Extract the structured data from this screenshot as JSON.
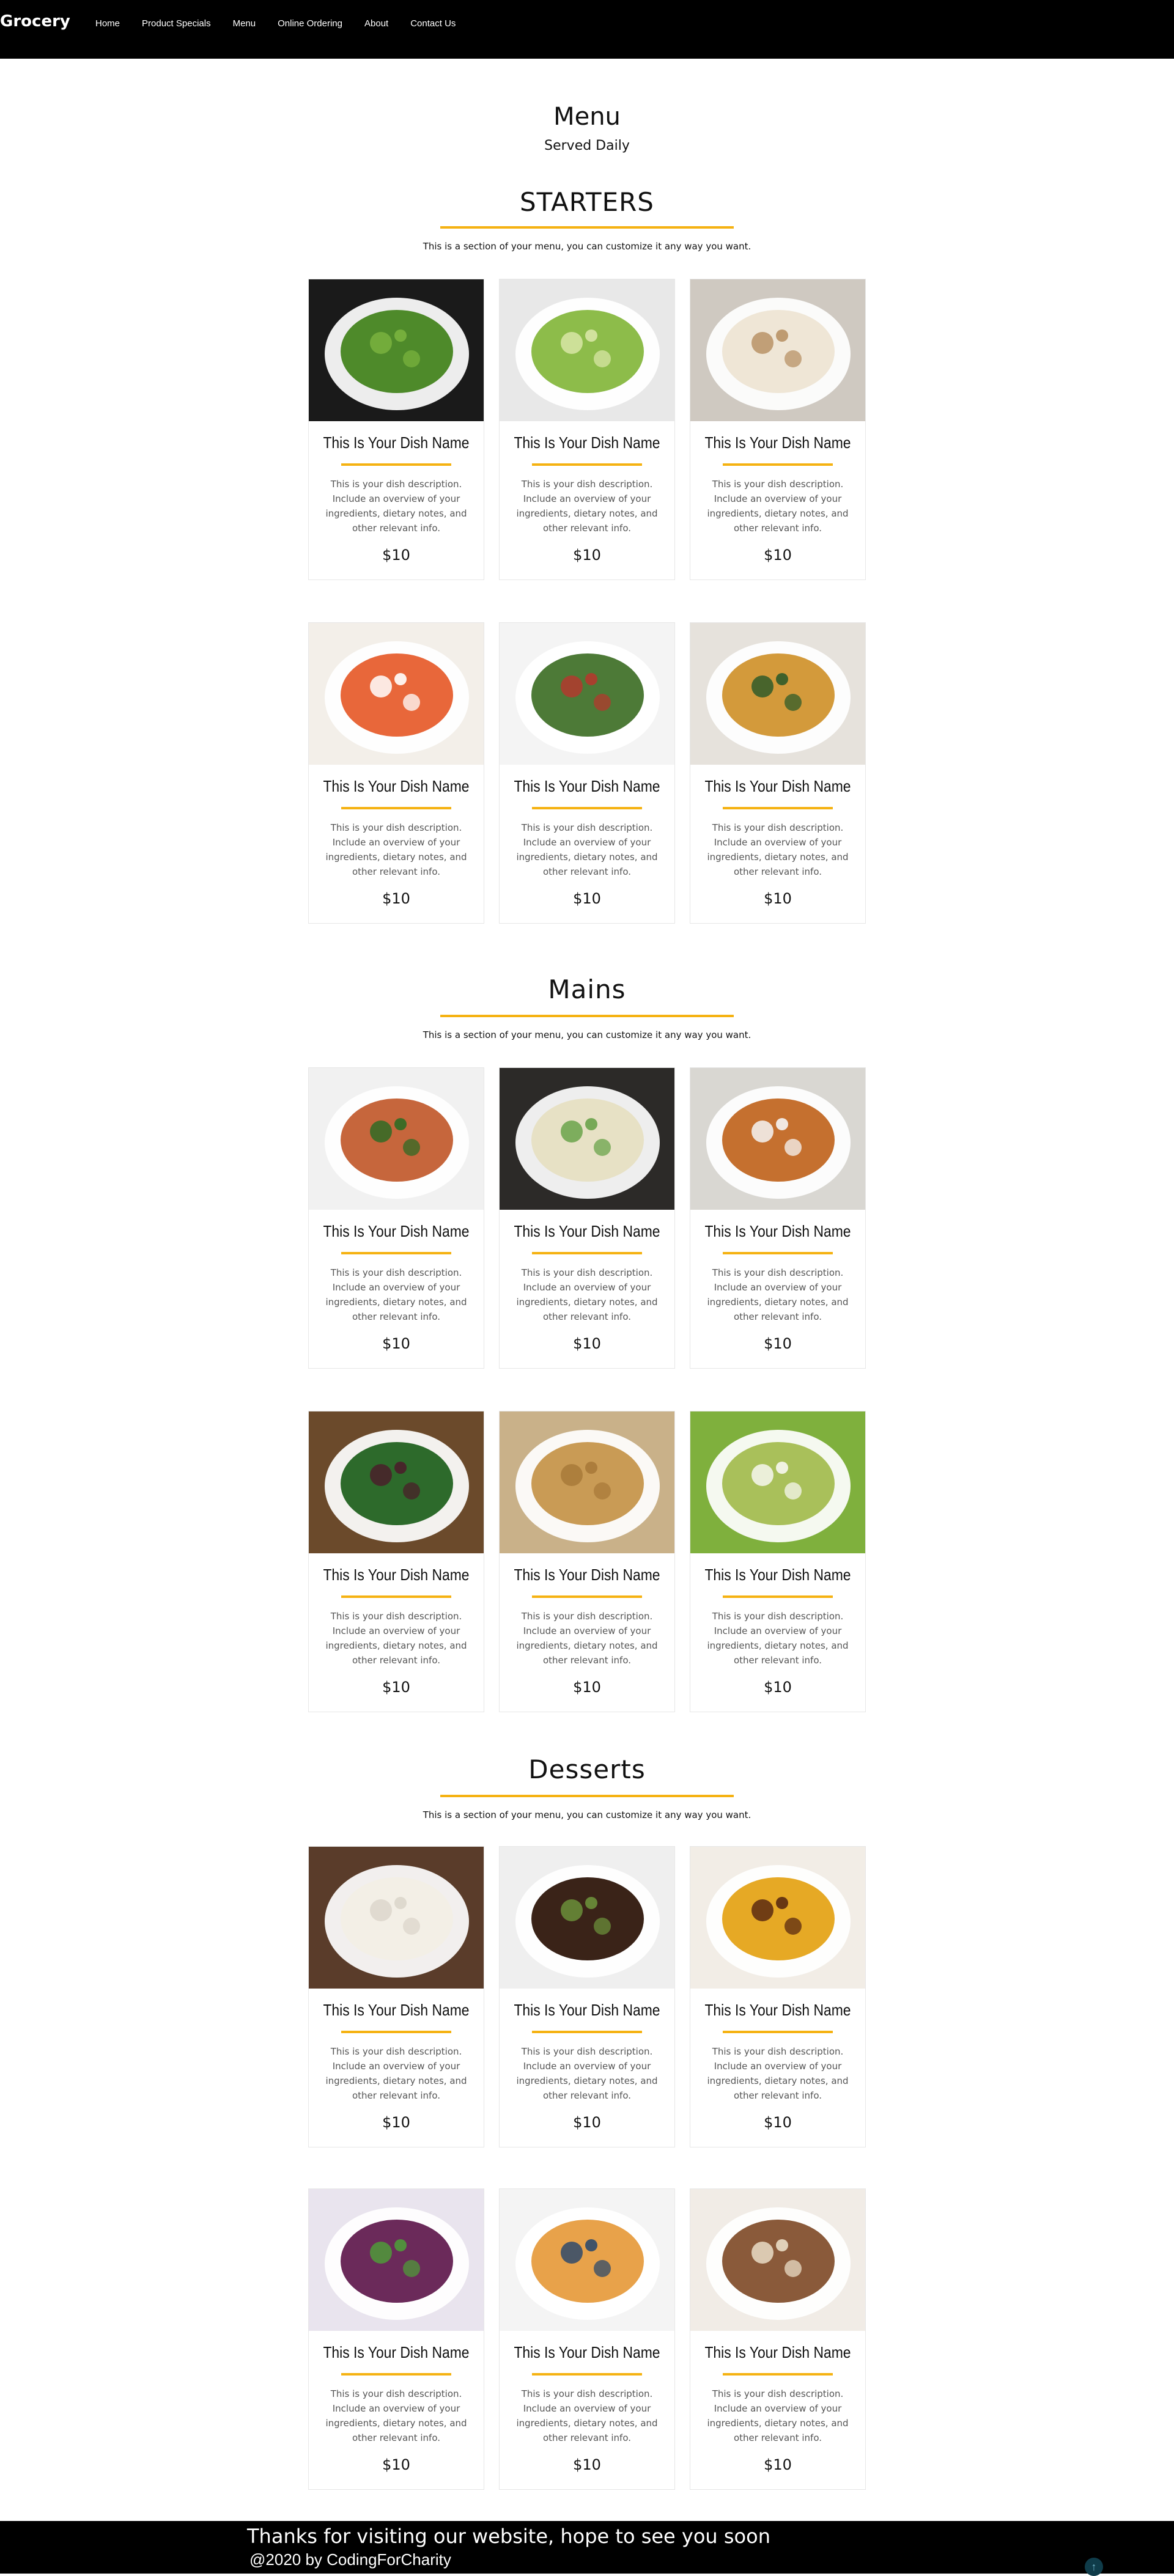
{
  "brand": "Grocery",
  "nav": [
    "Home",
    "Product Specials",
    "Menu",
    "Online Ordering",
    "About",
    "Contact Us"
  ],
  "page": {
    "title": "Menu",
    "subtitle": "Served Daily"
  },
  "sections": [
    {
      "title": "STARTERS",
      "note": "This is a section of your menu, you can customize it any way you want."
    },
    {
      "title": "Mains",
      "note": "This is a section of your menu, you can customize it any way you want."
    },
    {
      "title": "Desserts",
      "note": "This is a section of your menu, you can customize it any way you want."
    }
  ],
  "dish": {
    "name": "This Is Your Dish Name",
    "description": "This is your dish description. Include an overview of your ingredients, dietary notes, and other relevant info.",
    "price": "$10"
  },
  "photos": [
    "green salad with nuts",
    "cucumber salad",
    "cream soup",
    "tomato soup",
    "grilled vegetables",
    "penne with greens",
    "salmon fillet",
    "fish with asparagus",
    "tomato risotto",
    "spinach beet salad",
    "fettuccine",
    "pesto penne",
    "ice cream scoop",
    "chocolate lava cake",
    "caramel flan",
    "berry sorbet",
    "fruit salad",
    "tiramisu"
  ],
  "footer": {
    "thanks": "Thanks for visiting our website, hope to see you soon",
    "copyright": "@2020 by CodingForCharity"
  },
  "colors": {
    "accent": "#f5b212",
    "nav_bg": "#000000",
    "footer_bg": "#000000"
  },
  "icons": {
    "scroll_top": "arrow-up-icon"
  }
}
